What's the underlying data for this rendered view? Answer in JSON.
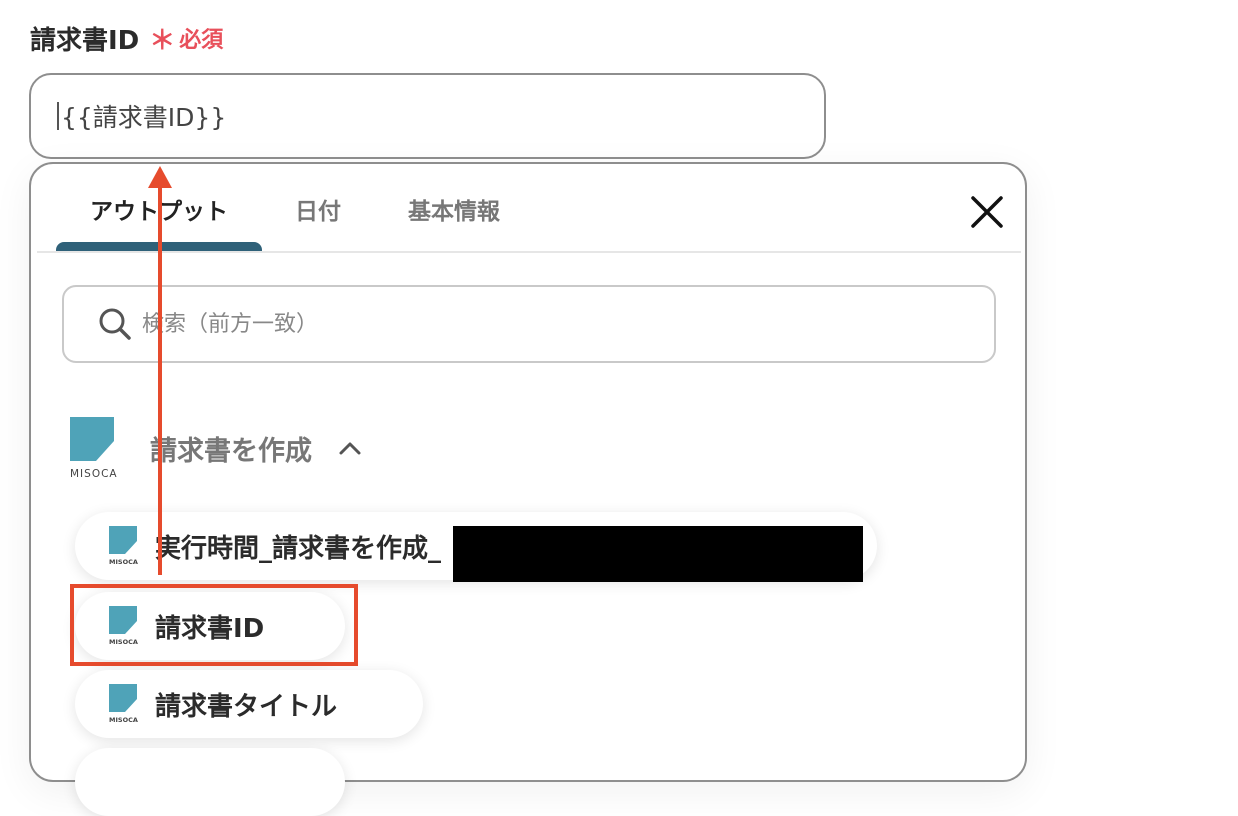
{
  "field": {
    "label": "請求書ID",
    "required_mark": "＊",
    "required_text": "必須",
    "value": "{{請求書ID}}"
  },
  "popup": {
    "tabs": [
      {
        "label": "アウトプット",
        "active": true
      },
      {
        "label": "日付",
        "active": false
      },
      {
        "label": "基本情報",
        "active": false
      }
    ],
    "search_placeholder": "検索（前方一致）",
    "section": {
      "title": "請求書を作成",
      "logo_text": "MISOCA",
      "expanded": true
    },
    "items": [
      {
        "label": "実行時間_請求書を作成_",
        "redacted": true
      },
      {
        "label": "請求書ID",
        "highlighted": true
      },
      {
        "label": "請求書タイトル"
      }
    ]
  },
  "colors": {
    "accent_tab": "#2f6179",
    "required": "#e8505b",
    "annotation": "#e64b2d",
    "misoca_logo": "#4fa3b8"
  },
  "icons": [
    "search-icon",
    "close-icon",
    "chevron-up-icon",
    "misoca-logo"
  ]
}
